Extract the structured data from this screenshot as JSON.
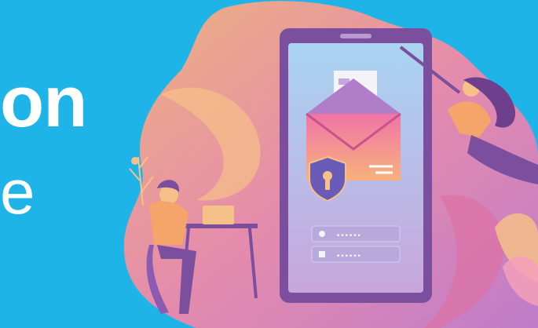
{
  "banner": {
    "headline": "on",
    "subline": "e"
  },
  "illustration": {
    "login_field_1_mask": "••••••",
    "login_field_2_mask": "••••••",
    "icons": [
      "envelope-icon",
      "document-icon",
      "shield-key-icon",
      "user-icon",
      "lock-icon"
    ]
  },
  "colors": {
    "background": "#1fb4e8",
    "phone_frame": "#7b4f9e",
    "screen": "#b8d8f4",
    "envelope": "#e0609a",
    "blob": "#f6a56a"
  }
}
